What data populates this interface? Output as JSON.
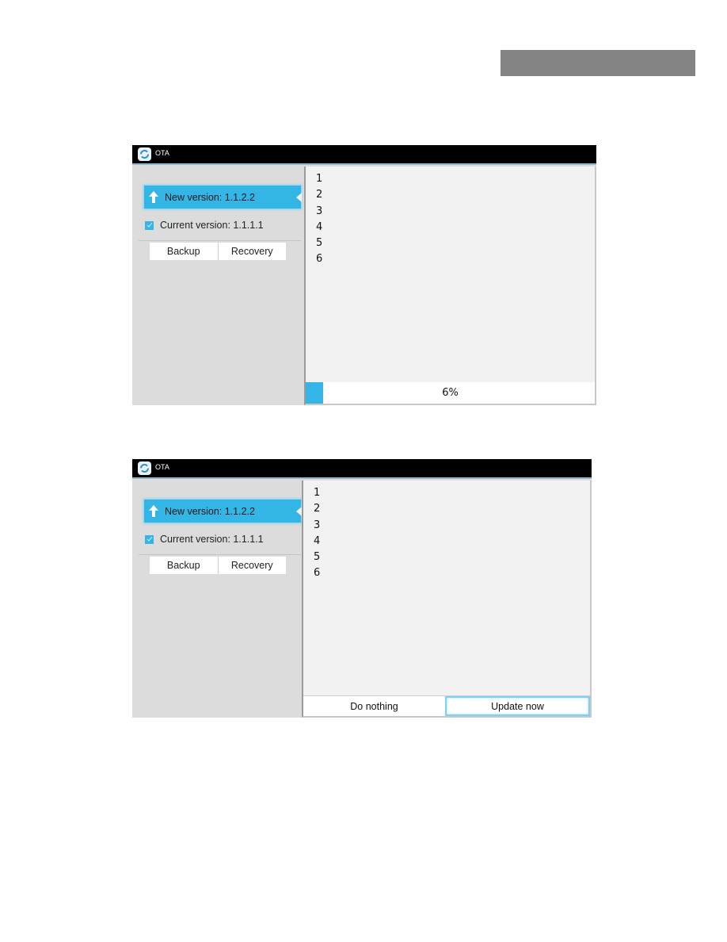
{
  "page": {
    "header_bar_color": "#848484"
  },
  "accent_color": "#33b5e5",
  "screenshots": [
    {
      "app": {
        "title": "OTA",
        "icon": "sync-icon"
      },
      "new_version": {
        "label": "New version: 1.1.2.2",
        "icon": "up-arrow-icon"
      },
      "current_version": {
        "label": "Current version: 1.1.1.1",
        "checked": true
      },
      "buttons": {
        "backup": "Backup",
        "recovery": "Recovery"
      },
      "release_notes": [
        "1",
        "2",
        "3",
        "4",
        "5",
        "6"
      ],
      "progress": {
        "value": 0.06,
        "label": "6%"
      }
    },
    {
      "app": {
        "title": "OTA",
        "icon": "sync-icon"
      },
      "new_version": {
        "label": "New version: 1.1.2.2",
        "icon": "up-arrow-icon"
      },
      "current_version": {
        "label": "Current version: 1.1.1.1",
        "checked": true
      },
      "buttons": {
        "backup": "Backup",
        "recovery": "Recovery"
      },
      "release_notes": [
        "1",
        "2",
        "3",
        "4",
        "5",
        "6"
      ],
      "actions": {
        "do_nothing": "Do nothing",
        "update_now": "Update now"
      }
    }
  ]
}
